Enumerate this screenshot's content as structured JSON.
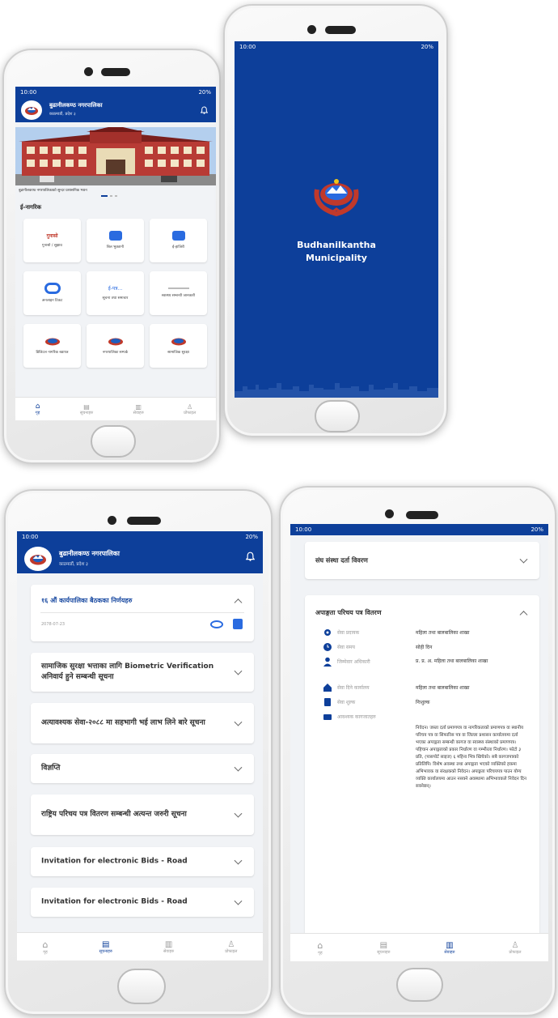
{
  "colors": {
    "primary": "#0d3f9a",
    "background": "#f1f3f6",
    "accent": "#2a6be0"
  },
  "status_bar": {
    "time": "10:00",
    "battery": "20%"
  },
  "app": {
    "title": "बुढानीलकण्ठ नगरपालिका",
    "subtitle": "काठमाडौं, प्रदेश ३",
    "logo_icon": "municipality-emblem-icon",
    "bell_icon": "bell-icon"
  },
  "splash": {
    "line1": "Budhanilkantha",
    "line2": "Municipality"
  },
  "home": {
    "banner_caption": "बुढानीलकण्ठ नगरपालिकाको सुन्दर प्रशासनिक भवन",
    "section_title": "ई-नागरिक",
    "services": [
      {
        "label": "गुनासो / सुझाव",
        "icon": "complaint-icon"
      },
      {
        "label": "बिल भुक्तानी",
        "icon": "bill-icon"
      },
      {
        "label": "ई-हाजिरी",
        "icon": "attendance-icon"
      },
      {
        "label": "अनलाइन टिकट",
        "icon": "ticket-icon"
      },
      {
        "label": "सूचना तथा समाचार",
        "icon": "news-icon"
      },
      {
        "label": "स्वास्थ्य सम्बन्धी जानकारी",
        "icon": "health-icon"
      },
      {
        "label": "डिजिटल नागरिक बडापत्र",
        "icon": "charter-icon"
      },
      {
        "label": "नगरपालिका सम्पर्क",
        "icon": "contact-icon"
      },
      {
        "label": "सामाजिक सुरक्षा",
        "icon": "security-icon"
      }
    ]
  },
  "nav": {
    "home": "गृह",
    "notices": "सूचनाहरु",
    "services": "सेवाहरु",
    "profile": "प्रोफाइल"
  },
  "notices": {
    "first": {
      "title": "१६ औं कार्यपालिका बैठकका निर्णयहरु",
      "date": "2078-07-23"
    },
    "items": [
      "सामाजिक सुरक्षा भत्ताका लागि Biometric Verification अनिवार्य हुने सम्बन्धी सूचना",
      "अत्यावश्यक सेवा-२०८८ मा सहभागी भई लाभ लिने बारे सूचना",
      "विज्ञप्ति",
      "राष्ट्रिय परिचय पत्र वितरण सम्बन्धी अत्यन्त जरुरी सूचना",
      "Invitation for electronic Bids - Road",
      "Invitation for electronic Bids - Road"
    ]
  },
  "detail": {
    "collapsed_title": "संघ संस्था दर्ता विवरण",
    "expanded_title": "अपाङ्गता परिचय पत्र वितरण",
    "rows": [
      {
        "label": "सेवा प्रदायक",
        "value": "महिला तथा बालबालिका शाखा",
        "icon": "gear-icon"
      },
      {
        "label": "सेवा समय",
        "value": "सोही दिन",
        "icon": "clock-icon"
      },
      {
        "label": "जिम्मेवार अधिकारी",
        "value": "प्र. प्र. अ. महिला तथा बालबालिका शाखा",
        "icon": "person-icon"
      },
      {
        "label": "सेवा दिने कार्यालय",
        "value": "महिला तथा बालबालिका शाखा",
        "icon": "building-icon"
      },
      {
        "label": "सेवा शुल्क",
        "value": "निःशुल्क",
        "icon": "fee-icon"
      },
      {
        "label": "आवश्यक कागजातहरु",
        "value": "",
        "icon": "document-icon"
      }
    ],
    "documents": "निवेदन। जस्ता दर्ता प्रमाणपत्र वा नागरिकताको प्रमाणपत्र वा स्थानीय परिचय पत्र वा सिफारिस पत्र वा जिल्ला प्रशासन कार्यालयमा दर्ता भएका अपाङ्गता सम्बन्धी कागज वा स्वास्थ्य संस्थाको प्रमाणपत्र। पहिचान अपाङ्गताको प्रकार निर्धारण वा गम्भीरता निर्धारण। फोटो ३ प्रति, (पासपोर्ट साइज) ६ महिना भित्र खिचेको। सबै कागजपत्रको प्रतिलिपि। विशेष अवस्था तथा अपाङ्गता भएको व्यक्तिको हकमा अभिभावक वा संरक्षकको निवेदन। अपाङ्गता परिचयपत्र पाउन योग्य व्यक्ति कार्यालयमा आउन नसक्ने अवस्थामा अभिभावकले निवेदन दिन सक्नेछन्।"
  }
}
